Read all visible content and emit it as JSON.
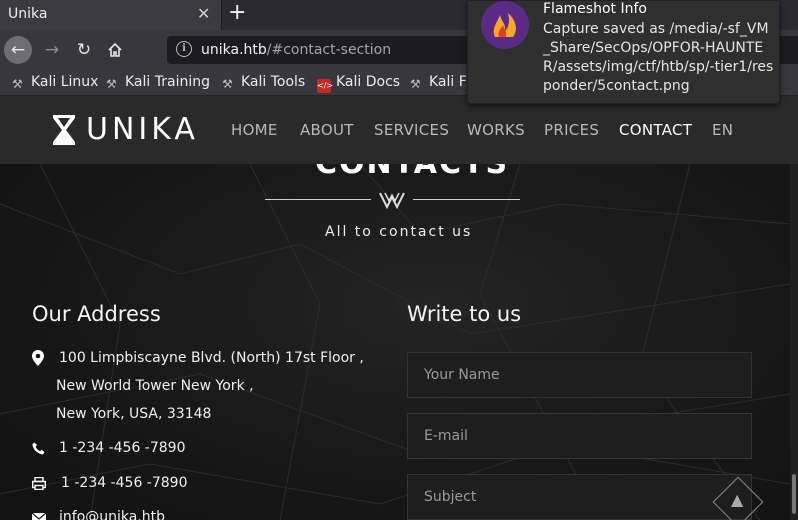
{
  "browser": {
    "tab_title": "Unika",
    "tab_close": "✕",
    "new_tab": "+",
    "url_host": "unika.htb",
    "url_path": "/#contact-section",
    "bookmarks": [
      {
        "label": "Kali Linux",
        "icon": "kali-dragon-icon"
      },
      {
        "label": "Kali Training",
        "icon": "kali-dragon-icon"
      },
      {
        "label": "Kali Tools",
        "icon": "kali-dragon-icon"
      },
      {
        "label": "Kali Docs",
        "icon": "docs-icon"
      },
      {
        "label": "Kali Forums",
        "icon": "kali-dragon-icon"
      }
    ]
  },
  "site": {
    "logo_text": "UNIKA",
    "menu": [
      "HOME",
      "ABOUT",
      "SERVICES",
      "WORKS",
      "PRICES",
      "CONTACT",
      "EN"
    ],
    "active_menu": "CONTACT"
  },
  "contact": {
    "title": "CONTACTS",
    "subtitle": "All to contact us",
    "address_heading": "Our Address",
    "address_lines": [
      "100 Limpbiscayne Blvd. (North) 17st Floor ,",
      "New World Tower New York ,",
      "New York, USA, 33148"
    ],
    "phone": "1 -234 -456 -7890",
    "fax": "1 -234 -456 -7890",
    "email": "info@unika.htb",
    "form_heading": "Write to us",
    "name_placeholder": "Your Name",
    "email_placeholder": "E-mail",
    "subject_placeholder": "Subject"
  },
  "notification": {
    "title": "Flameshot Info",
    "body": "Capture saved as /media/-sf_VM_Share/SecOps/OPFOR-HAUNTER/assets/img/ctf/htb/sp/-tier1/responder/5contact.png"
  },
  "colors": {
    "background": "#161616",
    "header": "#2a2a2a",
    "accent_white": "#ffffff",
    "menu_text": "#b9b9b9",
    "notification_icon": "#5b2a86"
  }
}
